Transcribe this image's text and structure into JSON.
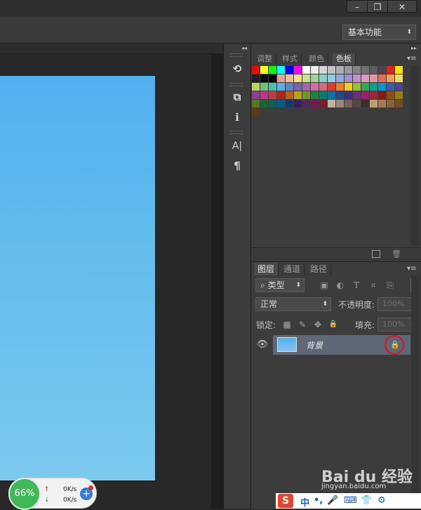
{
  "window": {
    "minimize_label": "–",
    "restore_label": "❐",
    "close_label": "✕"
  },
  "options_bar": {
    "workspace_label": "基本功能",
    "workspace_arrow": "⬍"
  },
  "icon_strip": {
    "collapse": "◂◂",
    "items": [
      {
        "icon": "history-icon",
        "glyph": "⟲"
      },
      {
        "icon": "3d-cube-icon",
        "glyph": "⧉"
      },
      {
        "icon": "info-icon",
        "glyph": "ℹ"
      },
      {
        "icon": "character-icon",
        "glyph": "A|"
      },
      {
        "icon": "paragraph-icon",
        "glyph": "¶"
      }
    ]
  },
  "swatches_panel": {
    "collapse": "▸▸",
    "tabs": [
      "调整",
      "样式",
      "颜色",
      "色板"
    ],
    "active_tab": 3,
    "menu": "▾≡",
    "colors": [
      "#ff0000",
      "#ffff00",
      "#00ff00",
      "#00ffff",
      "#0000ff",
      "#ff00ff",
      "#ffffff",
      "#ebebeb",
      "#d6d6d6",
      "#c2c2c2",
      "#adadad",
      "#999999",
      "#858585",
      "#707070",
      "#5c5c5c",
      "#474747",
      "#e02020",
      "#f7e600",
      "#1f1f1f",
      "#0a0a0a",
      "#000000",
      "#e8a08a",
      "#efbf8a",
      "#f1e48c",
      "#cbe08e",
      "#9ed49a",
      "#8ad3c4",
      "#8ecbe9",
      "#8fa8dd",
      "#9d90cf",
      "#c091c9",
      "#e296c2",
      "#e2959d",
      "#ea6c56",
      "#f3a15a",
      "#f5dd5c",
      "#b5d35e",
      "#6cc277",
      "#4dbfa9",
      "#4eb6e3",
      "#5d85cb",
      "#7365b5",
      "#a566af",
      "#d669a7",
      "#d76c79",
      "#e43b25",
      "#f07f20",
      "#f3cc1c",
      "#90c23a",
      "#30ab50",
      "#00a58a",
      "#0099d5",
      "#2d63b0",
      "#5340a0",
      "#8a3f98",
      "#c9308d",
      "#c8364e",
      "#b42318",
      "#bd6212",
      "#c1a00e",
      "#6f9a25",
      "#1c853d",
      "#00826d",
      "#0078a9",
      "#1c4a8a",
      "#3d2e7f",
      "#6e2e7b",
      "#a01e6f",
      "#a0223b",
      "#8d1a12",
      "#944d0c",
      "#987d09",
      "#557818",
      "#136a2f",
      "#006656",
      "#005e86",
      "#133a6e",
      "#2f2365",
      "#572361",
      "#7e1557",
      "#7e1b2d",
      "#c7b299",
      "#998675",
      "#736357",
      "#534741",
      "#37302a",
      "#c69c6d",
      "#a67c52",
      "#8c6239",
      "#754c24",
      "#603913"
    ]
  },
  "layers_panel": {
    "tabs": [
      "图层",
      "通道",
      "路径"
    ],
    "active_tab": 0,
    "menu": "▾≡",
    "filter_label": "类型",
    "filter_search_glyph": "⌕",
    "filter_icons": [
      {
        "icon": "pixel-filter-icon",
        "glyph": "▣"
      },
      {
        "icon": "adjustment-filter-icon",
        "glyph": "◐"
      },
      {
        "icon": "type-filter-icon",
        "glyph": "T"
      },
      {
        "icon": "shape-filter-icon",
        "glyph": "⌗"
      },
      {
        "icon": "smart-object-filter-icon",
        "glyph": "⎘"
      }
    ],
    "blend_mode": "正常",
    "opacity_label": "不透明度:",
    "opacity_value": "100%",
    "lock_label": "锁定:",
    "lock_icons": [
      {
        "icon": "lock-transparent-icon",
        "glyph": "▦"
      },
      {
        "icon": "lock-image-icon",
        "glyph": "✎"
      },
      {
        "icon": "lock-position-icon",
        "glyph": "✥"
      },
      {
        "icon": "lock-all-icon",
        "glyph": "🔒"
      }
    ],
    "fill_label": "填充:",
    "fill_value": "100%",
    "layer": {
      "name": "背景",
      "visible_glyph": "👁",
      "lock_glyph": "🔒"
    }
  },
  "network_widget": {
    "percent": "66%",
    "upload": "0K/s",
    "download": "0K/s",
    "up_arrow": "↑",
    "down_arrow": "↓",
    "boost": "+"
  },
  "ime": {
    "logo": "S",
    "items": [
      "中",
      "•,",
      "🎤",
      "⌨",
      "👕",
      "⚙"
    ]
  },
  "watermark": {
    "text": "Bai du 经验",
    "url": "jingyan.baidu.com"
  }
}
